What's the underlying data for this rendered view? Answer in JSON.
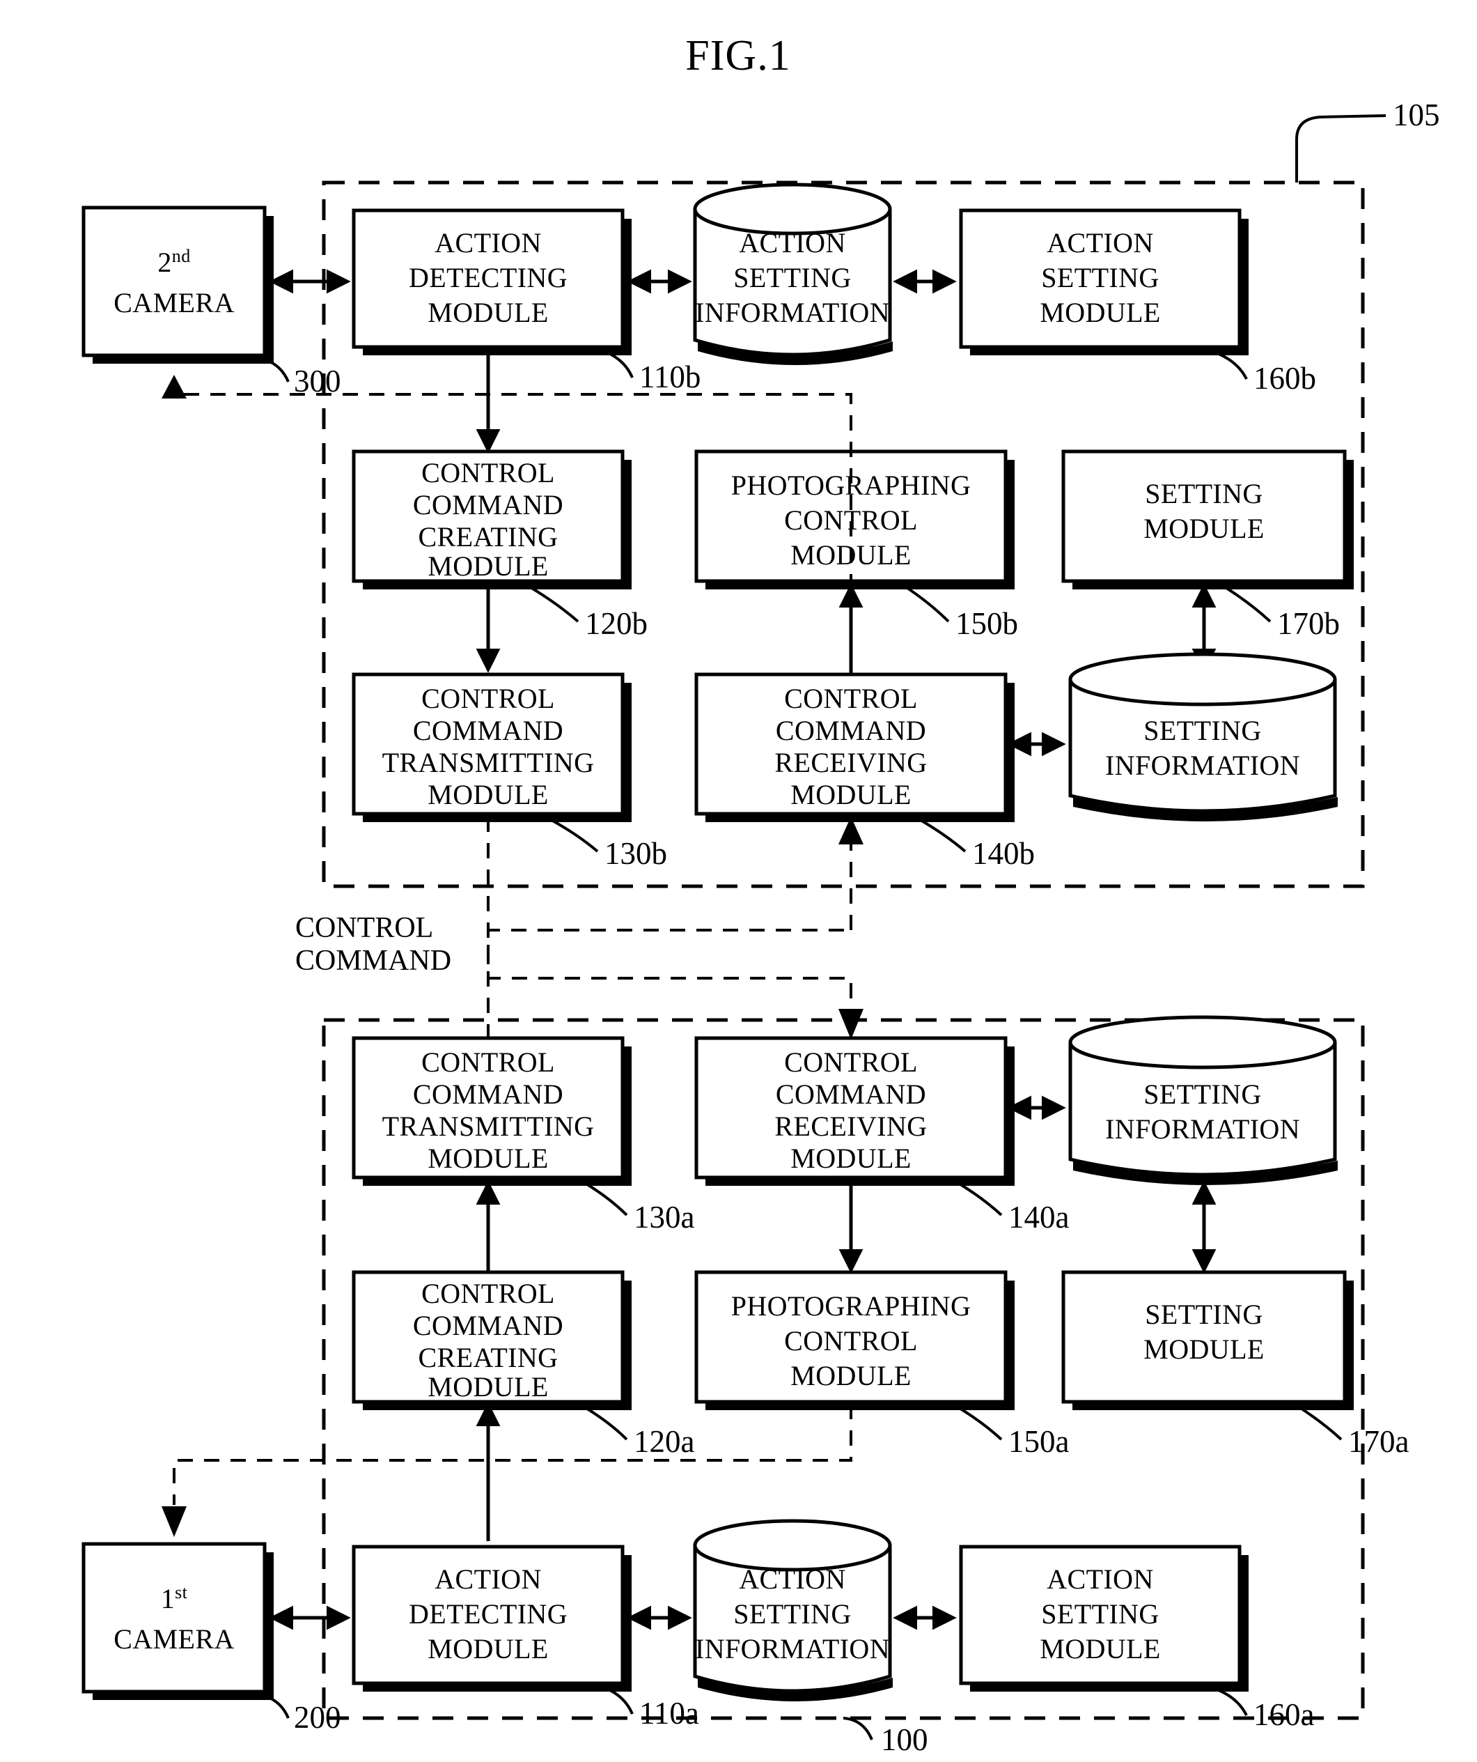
{
  "figure": {
    "title": "FIG.1"
  },
  "flow_label": {
    "line1": "CONTROL",
    "line2": "COMMAND"
  },
  "reference_numerals": {
    "upper_system": "105",
    "lower_system": "100",
    "second_camera": "300",
    "first_camera": "200",
    "action_detecting_upper": "110b",
    "action_detecting_lower": "110a",
    "cmd_creating_upper": "120b",
    "cmd_creating_lower": "120a",
    "cmd_transmitting_upper": "130b",
    "cmd_transmitting_lower": "130a",
    "cmd_receiving_upper": "140b",
    "cmd_receiving_lower": "140a",
    "photographing_control_upper": "150b",
    "photographing_control_lower": "150a",
    "action_setting_module_upper": "160b",
    "action_setting_module_lower": "160a",
    "setting_module_upper": "170b",
    "setting_module_lower": "170a"
  },
  "upper_system": {
    "second_camera": {
      "line1": "2",
      "sup": "nd",
      "line2": "CAMERA"
    },
    "action_detecting_module": {
      "line1": "ACTION",
      "line2": "DETECTING",
      "line3": "MODULE"
    },
    "action_setting_information": {
      "line1": "ACTION",
      "line2": "SETTING",
      "line3": "INFORMATION"
    },
    "action_setting_module": {
      "line1": "ACTION",
      "line2": "SETTING",
      "line3": "MODULE"
    },
    "control_command_creating_module": {
      "line1": "CONTROL",
      "line2": "COMMAND",
      "line3": "CREATING",
      "line4": "MODULE"
    },
    "photographing_control_module": {
      "line1": "PHOTOGRAPHING",
      "line2": "CONTROL",
      "line3": "MODULE"
    },
    "setting_module": {
      "line1": "SETTING",
      "line2": "MODULE"
    },
    "control_command_transmitting_module": {
      "line1": "CONTROL",
      "line2": "COMMAND",
      "line3": "TRANSMITTING",
      "line4": "MODULE"
    },
    "control_command_receiving_module": {
      "line1": "CONTROL",
      "line2": "COMMAND",
      "line3": "RECEIVING",
      "line4": "MODULE"
    },
    "setting_information": {
      "line1": "SETTING",
      "line2": "INFORMATION"
    }
  },
  "lower_system": {
    "first_camera": {
      "line1": "1",
      "sup": "st",
      "line2": "CAMERA"
    },
    "action_detecting_module": {
      "line1": "ACTION",
      "line2": "DETECTING",
      "line3": "MODULE"
    },
    "action_setting_information": {
      "line1": "ACTION",
      "line2": "SETTING",
      "line3": "INFORMATION"
    },
    "action_setting_module": {
      "line1": "ACTION",
      "line2": "SETTING",
      "line3": "MODULE"
    },
    "control_command_creating_module": {
      "line1": "CONTROL",
      "line2": "COMMAND",
      "line3": "CREATING",
      "line4": "MODULE"
    },
    "photographing_control_module": {
      "line1": "PHOTOGRAPHING",
      "line2": "CONTROL",
      "line3": "MODULE"
    },
    "setting_module": {
      "line1": "SETTING",
      "line2": "MODULE"
    },
    "control_command_transmitting_module": {
      "line1": "CONTROL",
      "line2": "COMMAND",
      "line3": "TRANSMITTING",
      "line4": "MODULE"
    },
    "control_command_receiving_module": {
      "line1": "CONTROL",
      "line2": "COMMAND",
      "line3": "RECEIVING",
      "line4": "MODULE"
    },
    "setting_information": {
      "line1": "SETTING",
      "line2": "INFORMATION"
    }
  },
  "colors": {
    "ink": "#000000",
    "paper": "#ffffff"
  }
}
